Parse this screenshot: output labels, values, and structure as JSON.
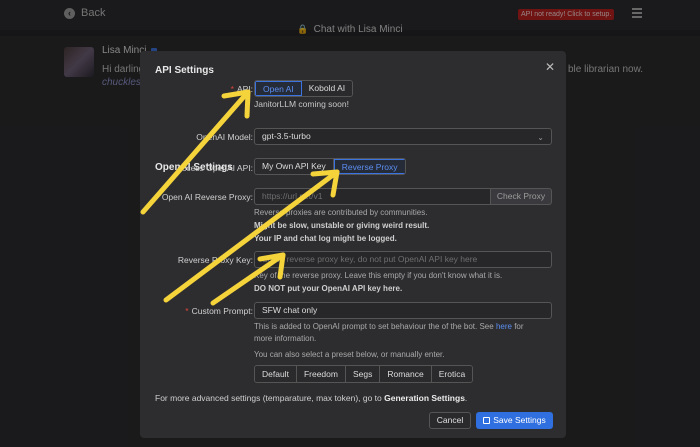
{
  "topbar": {
    "back_label": "Back",
    "api_warning": "API not ready! Click to setup."
  },
  "chat": {
    "title": "Chat with Lisa Minci",
    "sender_name": "Lisa Minci",
    "message_text": "Hi darling,",
    "message_tail": "ble librarian now.",
    "message_italic": "chuckles"
  },
  "modal": {
    "title": "API Settings",
    "api_label": "API:",
    "api_options": [
      "Open AI",
      "Kobold AI"
    ],
    "api_selected": "Open AI",
    "janitor_note": "JanitorLLM coming soon!",
    "openai_section": "OpenAI Settings",
    "model_label": "OpenAI Model:",
    "model_value": "gpt-3.5-turbo",
    "access_label": "Access OpenAI API:",
    "access_options": [
      "My Own API Key",
      "Reverse Proxy"
    ],
    "access_selected": "Reverse Proxy",
    "proxy_label": "Open AI Reverse Proxy:",
    "proxy_placeholder": "https://url.net/v1",
    "check_proxy": "Check Proxy",
    "proxy_hint_1": "Reverse proxies are contributed by communities.",
    "proxy_hint_2": "Might be slow, unstable or giving weird result.",
    "proxy_hint_3": "Your IP and chat log might be logged.",
    "proxy_key_label": "Reverse Proxy Key:",
    "proxy_key_placeholder": "Some reverse proxy key, do not put OpenAI API key here",
    "proxy_key_hint_1": "Key of the reverse proxy. Leave this empty if you don't know what it is.",
    "proxy_key_hint_2": "DO NOT put your OpenAI API key here.",
    "prompt_label": "Custom Prompt:",
    "prompt_value": "SFW chat only",
    "prompt_hint_1": "This is added to OpenAI prompt to set behaviour the of the bot. See",
    "prompt_hint_link": "here",
    "prompt_hint_2": "for",
    "prompt_hint_3": "more information.",
    "preset_hint": "You can also select a preset below, or manually enter.",
    "presets": [
      "Default",
      "Freedom",
      "Segs",
      "Romance",
      "Erotica"
    ],
    "footer_text": "For more advanced settings (temparature, max token), go to",
    "footer_link": "Generation Settings",
    "footer_end": ".",
    "cancel_label": "Cancel",
    "save_label": "Save Settings"
  },
  "colors": {
    "accent": "#2f6fe0",
    "warning": "#b31f1f",
    "arrow": "#f5d33a"
  }
}
